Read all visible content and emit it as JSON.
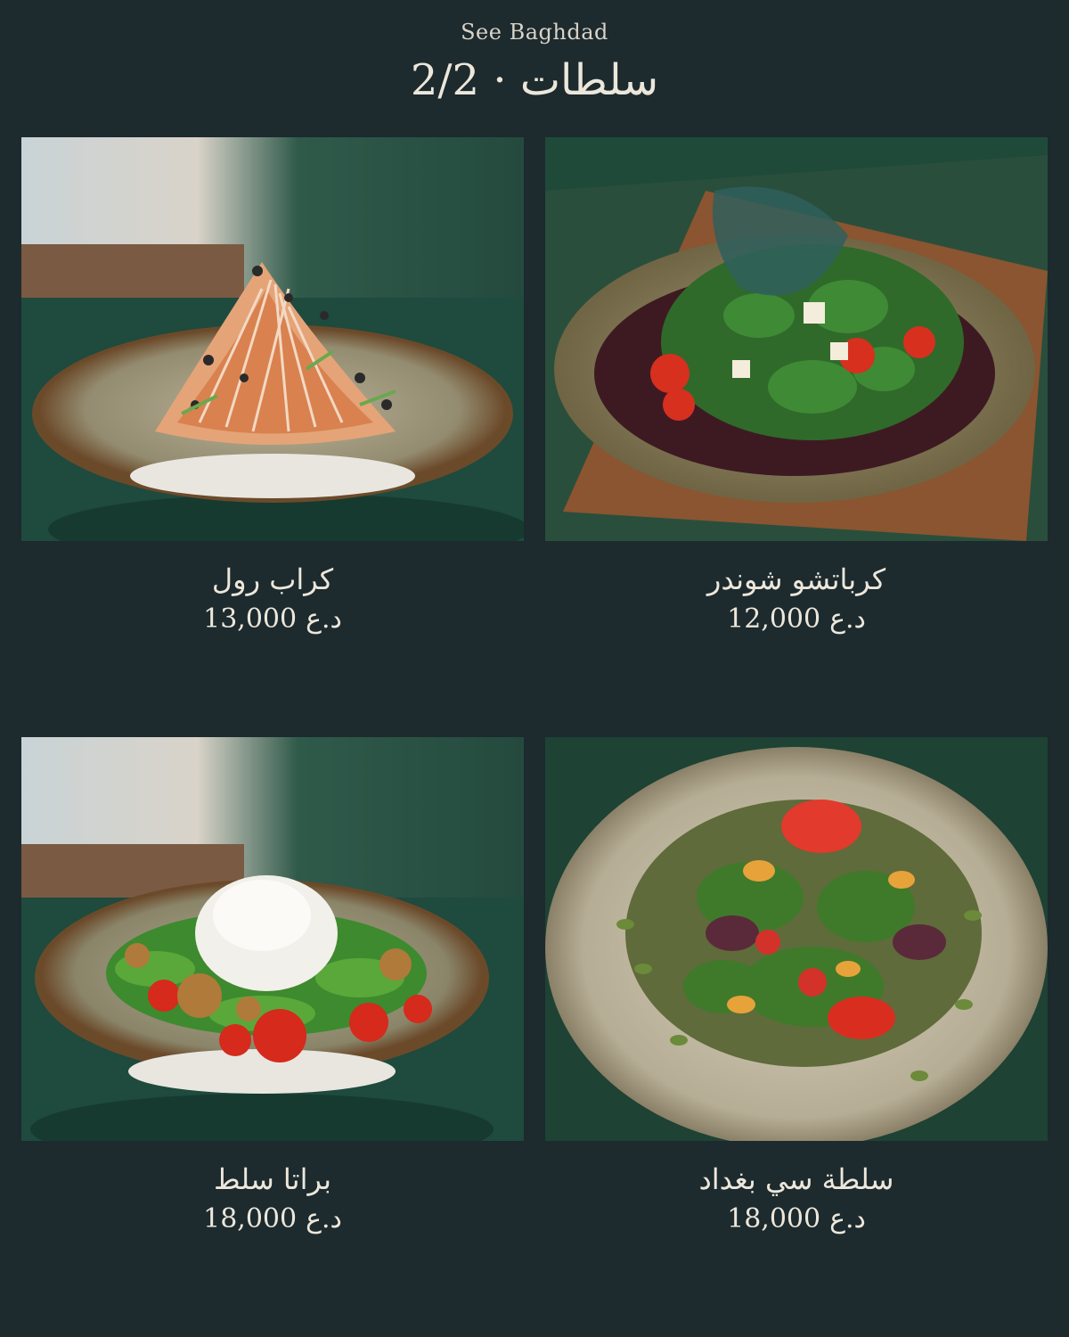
{
  "header": {
    "brand": "See Baghdad",
    "title": "سلطات · 2/2"
  },
  "items": [
    {
      "name": "كراب رول",
      "price": "13,000",
      "currency": "د.ع",
      "image_icon": "crab-roll-salad-photo"
    },
    {
      "name": "كرباتشو شوندر",
      "price": "12,000",
      "currency": "د.ع",
      "image_icon": "beet-carpaccio-photo"
    },
    {
      "name": "براتا سلط",
      "price": "18,000",
      "currency": "د.ع",
      "image_icon": "burrata-salad-photo"
    },
    {
      "name": "سلطة سي بغداد",
      "price": "18,000",
      "currency": "د.ع",
      "image_icon": "see-baghdad-salad-photo"
    }
  ],
  "colors": {
    "background": "#1d2a2e",
    "text": "#ece7db"
  }
}
